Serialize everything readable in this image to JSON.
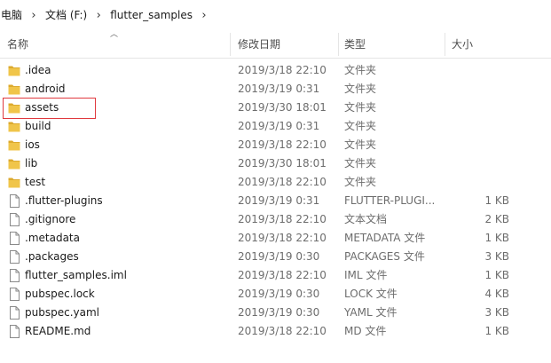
{
  "breadcrumb": [
    "电脑",
    "文档 (F:)",
    "flutter_samples"
  ],
  "columns": {
    "name": "名称",
    "modified": "修改日期",
    "type": "类型",
    "size": "大小"
  },
  "files": [
    {
      "name": ".idea",
      "modified": "2019/3/18 22:10",
      "type": "文件夹",
      "size": "",
      "icon": "folder-icon"
    },
    {
      "name": "android",
      "modified": "2019/3/19 0:31",
      "type": "文件夹",
      "size": "",
      "icon": "folder-icon"
    },
    {
      "name": "assets",
      "modified": "2019/3/30 18:01",
      "type": "文件夹",
      "size": "",
      "icon": "folder-icon"
    },
    {
      "name": "build",
      "modified": "2019/3/19 0:31",
      "type": "文件夹",
      "size": "",
      "icon": "folder-icon"
    },
    {
      "name": "ios",
      "modified": "2019/3/18 22:10",
      "type": "文件夹",
      "size": "",
      "icon": "folder-icon"
    },
    {
      "name": "lib",
      "modified": "2019/3/30 18:01",
      "type": "文件夹",
      "size": "",
      "icon": "folder-icon"
    },
    {
      "name": "test",
      "modified": "2019/3/18 22:10",
      "type": "文件夹",
      "size": "",
      "icon": "folder-icon"
    },
    {
      "name": ".flutter-plugins",
      "modified": "2019/3/19 0:31",
      "type": "FLUTTER-PLUGI...",
      "size": "1 KB",
      "icon": "file-icon"
    },
    {
      "name": ".gitignore",
      "modified": "2019/3/18 22:10",
      "type": "文本文档",
      "size": "2 KB",
      "icon": "file-icon"
    },
    {
      "name": ".metadata",
      "modified": "2019/3/18 22:10",
      "type": "METADATA 文件",
      "size": "1 KB",
      "icon": "file-icon"
    },
    {
      "name": ".packages",
      "modified": "2019/3/19 0:30",
      "type": "PACKAGES 文件",
      "size": "3 KB",
      "icon": "file-icon"
    },
    {
      "name": "flutter_samples.iml",
      "modified": "2019/3/18 22:10",
      "type": "IML 文件",
      "size": "1 KB",
      "icon": "file-icon"
    },
    {
      "name": "pubspec.lock",
      "modified": "2019/3/19 0:30",
      "type": "LOCK 文件",
      "size": "4 KB",
      "icon": "file-icon"
    },
    {
      "name": "pubspec.yaml",
      "modified": "2019/3/19 0:30",
      "type": "YAML 文件",
      "size": "3 KB",
      "icon": "file-icon"
    },
    {
      "name": "README.md",
      "modified": "2019/3/18 22:10",
      "type": "MD 文件",
      "size": "1 KB",
      "icon": "file-icon"
    }
  ],
  "highlighted": "assets",
  "colors": {
    "folder": "#f0c54a",
    "folder_dark": "#dcaa2e",
    "highlight_border": "#e0393e",
    "secondary_text": "#6d6d6d"
  }
}
